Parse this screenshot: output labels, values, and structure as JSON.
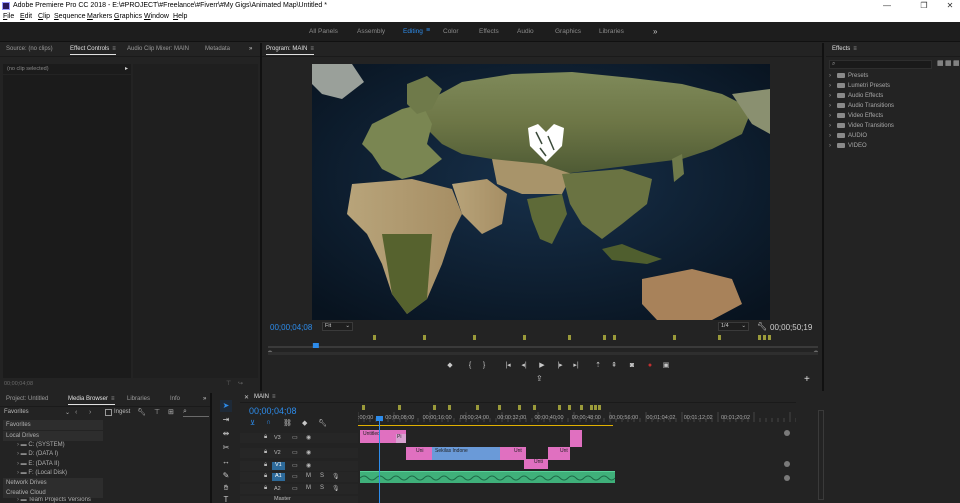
{
  "window": {
    "title": "Adobe Premiere Pro CC 2018 - E:\\#PROJECT\\#Freelance\\#Fiverr\\#My Gigs\\Animated Map\\Untitled *"
  },
  "menu": [
    "File",
    "Edit",
    "Clip",
    "Sequence",
    "Markers",
    "Graphics",
    "Window",
    "Help"
  ],
  "workspaces": {
    "items": [
      "All Panels",
      "Assembly",
      "Editing",
      "Color",
      "Effects",
      "Audio",
      "Graphics",
      "Libraries"
    ],
    "active": "Editing"
  },
  "source_panel": {
    "tabs": [
      "Source: (no clips)",
      "Effect Controls",
      "Audio Clip Mixer: MAIN",
      "Metadata"
    ],
    "active_tab": "Effect Controls",
    "no_clip_text": "(no clip selected)",
    "timecode": "00;00;04;08"
  },
  "program_panel": {
    "title": "Program: MAIN",
    "timecode_current": "00;00;04;08",
    "timecode_duration": "00;00;50;19",
    "fit": "Fit",
    "quality": "1/4",
    "playhead_fraction": 0.087
  },
  "effects_panel": {
    "title": "Effects",
    "items": [
      "Presets",
      "Lumetri Presets",
      "Audio Effects",
      "Audio Transitions",
      "Video Effects",
      "Video Transitions",
      "AUDIO",
      "VIDEO"
    ]
  },
  "project_panel": {
    "tabs": [
      "Project: Untitled",
      "Media Browser",
      "Libraries",
      "Info"
    ],
    "active_tab": "Media Browser",
    "favorites_select": "Favorites",
    "ingest_label": "Ingest",
    "tree": [
      {
        "label": "Favorites",
        "header": true
      },
      {
        "label": "Local Drives",
        "header": true
      },
      {
        "label": "C: (SYSTEM)",
        "header": false
      },
      {
        "label": "D: (DATA I)",
        "header": false
      },
      {
        "label": "E: (DATA II)",
        "header": false
      },
      {
        "label": "F: (Local Disk)",
        "header": false
      },
      {
        "label": "Network Drives",
        "header": true
      },
      {
        "label": "Creative Cloud",
        "header": true
      },
      {
        "label": "Team Projects Versions",
        "header": false
      }
    ]
  },
  "timeline": {
    "sequence_name": "MAIN",
    "timecode": "00;00;04;08",
    "ruler_labels": [
      ":00;00",
      "00;00;08;00",
      "00;00;16;00",
      "00;00;24;00",
      "00;00;32;00",
      "00;00;40;00",
      "00;00;48;00",
      "00;00;56;00",
      "00;01;04;02",
      "00;01;12;02",
      "00;01;20;02"
    ],
    "tracks": [
      "V3",
      "V2",
      "V1",
      "A1",
      "A2",
      "Master"
    ],
    "clip_labels": {
      "v3_a": "Untitled",
      "v3_b": "Pi",
      "v2_a": "Uni",
      "v2_b": "Sekilas Indone",
      "v2_c": "Unt",
      "v2_d": "Unt",
      "v1_a": "Unti"
    }
  },
  "colors": {
    "accent_blue": "#2d8ceb",
    "clip_pink": "#e070c0",
    "clip_blue": "#6a9ad8",
    "audio_green": "#3fb07a",
    "marker_olive": "#9a9a3a"
  }
}
